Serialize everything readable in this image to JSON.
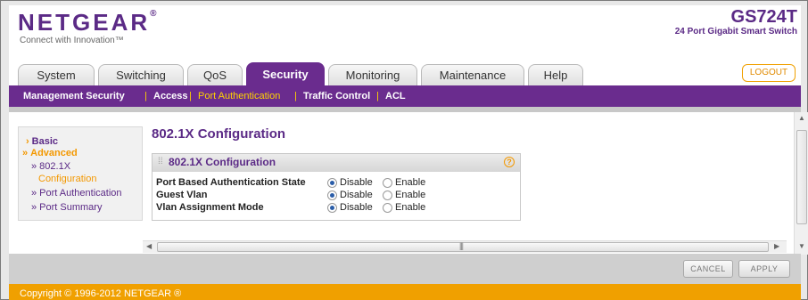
{
  "header": {
    "brand": "NETGEAR",
    "tagline": "Connect with Innovation™",
    "model": "GS724T",
    "model_desc": "24 Port Gigabit Smart Switch",
    "logout_label": "LOGOUT"
  },
  "tabs": [
    "System",
    "Switching",
    "QoS",
    "Security",
    "Monitoring",
    "Maintenance",
    "Help"
  ],
  "subnav": [
    "Management Security",
    "Access",
    "Port Authentication",
    "Traffic Control",
    "ACL"
  ],
  "sidebar": {
    "basic": "Basic",
    "advanced": "Advanced",
    "item_8021x_a": "» 802.1X",
    "item_8021x_b": "Configuration",
    "port_auth": "» Port Authentication",
    "port_summary": "» Port Summary"
  },
  "page_title": "802.1X Configuration",
  "panel": {
    "title": "802.1X Configuration",
    "rows": [
      {
        "label": "Port Based Authentication State",
        "opt1": "Disable",
        "opt2": "Enable",
        "selected": "Disable"
      },
      {
        "label": "Guest Vlan",
        "opt1": "Disable",
        "opt2": "Enable",
        "selected": "Disable"
      },
      {
        "label": "Vlan Assignment Mode",
        "opt1": "Disable",
        "opt2": "Enable",
        "selected": "Disable"
      }
    ]
  },
  "buttons": {
    "cancel": "CANCEL",
    "apply": "APPLY"
  },
  "copyright": "Copyright © 1996-2012 NETGEAR ®",
  "colors": {
    "brand_purple": "#6a2c8e",
    "accent_orange": "#f39800"
  }
}
